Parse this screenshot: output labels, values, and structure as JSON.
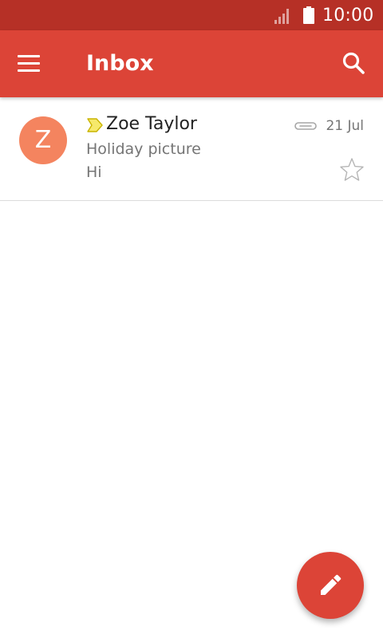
{
  "status_bar": {
    "time": "10:00",
    "signal_icon": "cellular-signal-icon",
    "battery_icon": "battery-full-icon"
  },
  "app_bar": {
    "title": "Inbox",
    "menu_icon": "hamburger-menu-icon",
    "search_icon": "search-icon"
  },
  "emails": [
    {
      "avatar_letter": "Z",
      "sender": "Zoe Taylor",
      "subject": "Holiday picture",
      "snippet": "Hi",
      "date": "21 Jul",
      "has_attachment": true,
      "important": true,
      "starred": false,
      "avatar_color": "#f4845f"
    }
  ],
  "fab": {
    "icon": "compose-pencil-icon"
  },
  "colors": {
    "status_bar": "#b63026",
    "app_bar": "#dc4437",
    "accent": "#dc4437",
    "importance_marker": "#f6e96b"
  }
}
